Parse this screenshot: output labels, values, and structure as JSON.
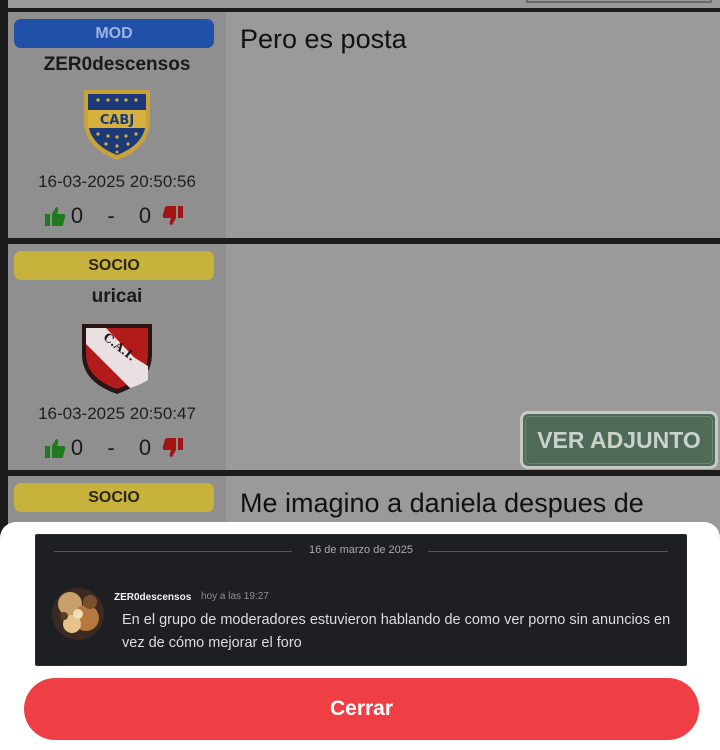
{
  "posts": [
    {
      "badge": "MOD",
      "username": "ZER0descensos",
      "crest": "boca-juniors-crest",
      "crest_text": "CABJ",
      "timestamp": "16-03-2025 20:50:56",
      "likes": "0",
      "dash": "-",
      "dislikes": "0",
      "text": "Pero es posta"
    },
    {
      "badge": "SOCIO",
      "username": "uricai",
      "crest": "independiente-crest",
      "crest_text": "C.A.I.",
      "timestamp": "16-03-2025 20:50:47",
      "likes": "0",
      "dash": "-",
      "dislikes": "0",
      "attachment_label": "VER ADJUNTO"
    },
    {
      "badge": "SOCIO",
      "text": "Me imagino a daniela despues de"
    }
  ],
  "modal": {
    "screenshot": {
      "date_divider": "16 de marzo de 2025",
      "author": "ZER0descensos",
      "time": "hoy a las 19:27",
      "message": "En el grupo de moderadores estuvieron hablando de como ver  porno sin anuncios en vez de cómo mejorar el foro"
    },
    "close_label": "Cerrar"
  },
  "colors": {
    "mod_badge": "#2050a8",
    "socio_badge": "#c7b23b",
    "close_button": "#ef3f44",
    "thumb_up": "#1f7a1f",
    "thumb_down": "#a01414"
  }
}
